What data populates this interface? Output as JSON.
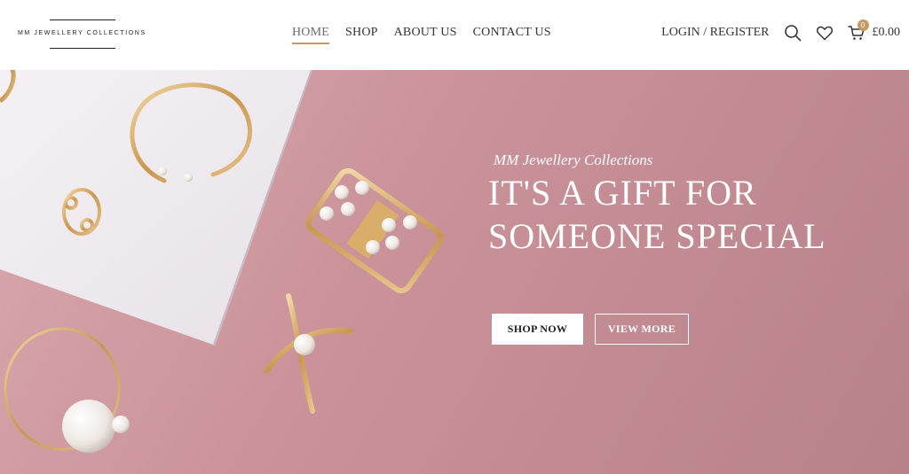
{
  "header": {
    "logo_text": "MM JEWELLERY COLLECTIONS",
    "nav": [
      {
        "label": "HOME",
        "active": true
      },
      {
        "label": "SHOP",
        "active": false
      },
      {
        "label": "ABOUT US",
        "active": false
      },
      {
        "label": "CONTACT US",
        "active": false
      }
    ],
    "login_label": "LOGIN / REGISTER",
    "icons": [
      "search-icon",
      "heart-icon",
      "cart-icon"
    ],
    "cart_count": "0",
    "cart_total": "£0.00",
    "accent_color": "#c59a63"
  },
  "hero": {
    "subtitle": "MM Jewellery Collections",
    "title_line1": "IT'S A GIFT FOR",
    "title_line2": "SOMEONE SPECIAL",
    "primary_button": "SHOP NOW",
    "secondary_button": "VIEW MORE",
    "background_color": "#c99198"
  }
}
